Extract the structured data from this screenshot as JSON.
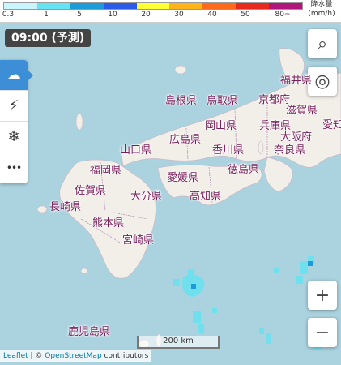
{
  "legend": {
    "ticks": [
      "0.3",
      "1",
      "5",
      "10",
      "20",
      "30",
      "40",
      "50",
      "80~"
    ],
    "unit_line1": "降水量",
    "unit_line2": "(mm/h)",
    "colors": [
      "#c9f5ff",
      "#66e3f2",
      "#1b9bd8",
      "#2a5ce8",
      "#ffff33",
      "#ffb31a",
      "#ff6a1a",
      "#e82a1e",
      "#b0157a"
    ]
  },
  "time_label": "09:00 (予測)",
  "sidebar": [
    {
      "name": "rain-cloud-icon",
      "glyph": "☁"
    },
    {
      "name": "lightning-icon",
      "glyph": "⚡"
    },
    {
      "name": "snowflake-icon",
      "glyph": "❄"
    },
    {
      "name": "more-icon",
      "glyph": "•••"
    }
  ],
  "controls": {
    "search_glyph": "⌕",
    "locate_glyph": "◎",
    "zoom_in": "+",
    "zoom_out": "−"
  },
  "prefectures": {
    "fukui": "福井県",
    "kyoto": "京都府",
    "shimane": "島根県",
    "tottori": "鳥取県",
    "shiga": "滋賀県",
    "aichi": "愛知",
    "okayama": "岡山県",
    "hiroshima": "広島県",
    "hyogo": "兵庫県",
    "osaka": "大阪府",
    "yamaguchi": "山口県",
    "kagawa": "香川県",
    "nara": "奈良県",
    "fukuoka": "福岡県",
    "ehime": "愛媛県",
    "tokushima": "徳島県",
    "saga": "佐賀県",
    "oita": "大分県",
    "kochi": "高知県",
    "nagasaki": "長崎県",
    "kumamoto": "熊本県",
    "miyazaki": "宮崎県",
    "kagoshima": "鹿児島県"
  },
  "scale_label": "200 km",
  "attribution": {
    "leaflet": "Leaflet",
    "sep": " | © ",
    "osm": "OpenStreetMap",
    "suffix": " contributors"
  }
}
